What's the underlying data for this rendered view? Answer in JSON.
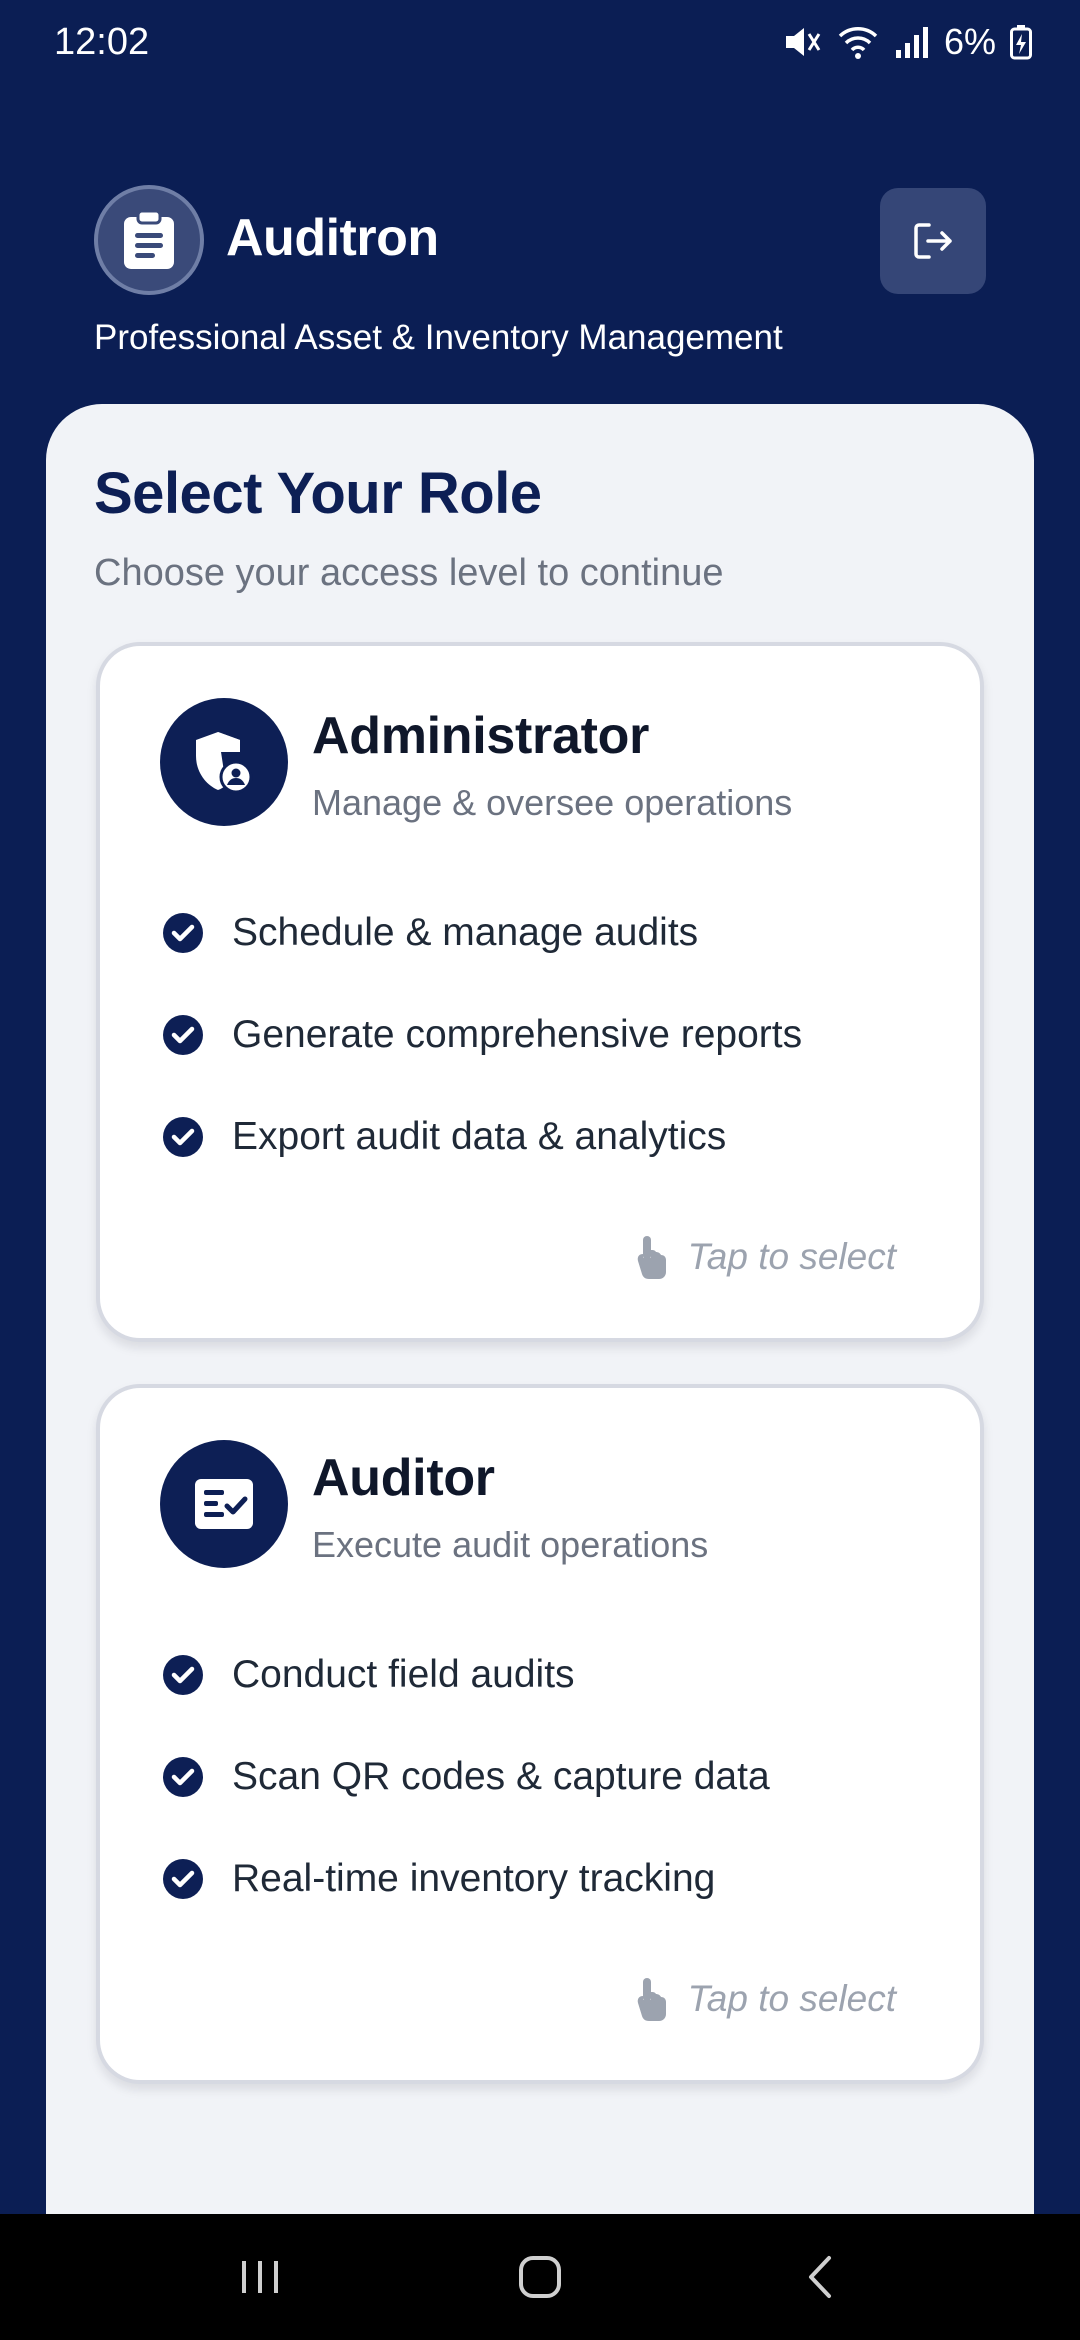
{
  "status_bar": {
    "time": "12:02",
    "battery": "6%"
  },
  "header": {
    "app_name": "Auditron",
    "tagline": "Professional Asset & Inventory Management",
    "logo_icon": "clipboard-icon",
    "logout_icon": "logout-icon"
  },
  "content": {
    "heading": "Select Your Role",
    "subheading": "Choose your access level to continue",
    "roles": [
      {
        "title": "Administrator",
        "description": "Manage & oversee operations",
        "icon": "shield-user-icon",
        "features": [
          "Schedule & manage audits",
          "Generate comprehensive reports",
          "Export audit data & analytics"
        ],
        "hint": "Tap to select"
      },
      {
        "title": "Auditor",
        "description": "Execute audit operations",
        "icon": "checklist-icon",
        "features": [
          "Conduct field audits",
          "Scan QR codes & capture data",
          "Real-time inventory tracking"
        ],
        "hint": "Tap to select"
      }
    ]
  },
  "colors": {
    "primary": "#0b1e54",
    "sheet": "#f1f3f7",
    "card": "#ffffff",
    "muted_text": "#6b7280",
    "hint_text": "#9ca3af"
  }
}
